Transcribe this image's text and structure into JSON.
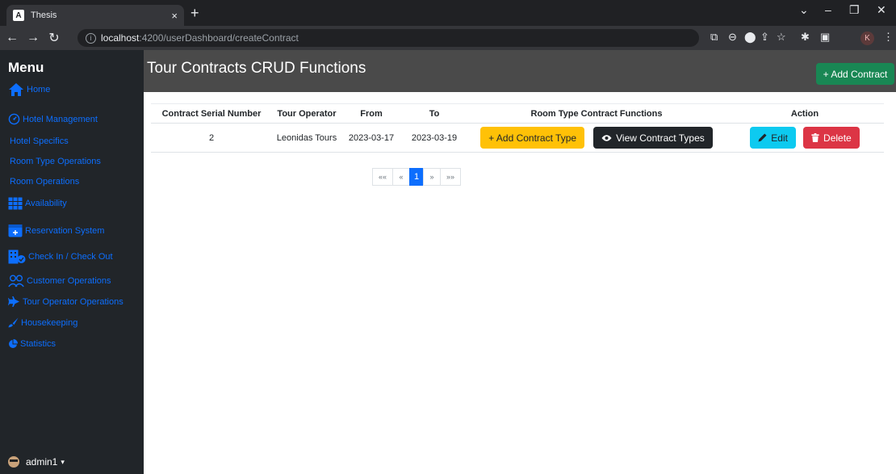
{
  "browser": {
    "tab_title": "Thesis",
    "tab_favicon": "A",
    "tab_close": "×",
    "new_tab": "+",
    "url_host": "localhost",
    "url_path": ":4200/userDashboard/createContract",
    "profile_initial": "K"
  },
  "sidebar": {
    "title": "Menu",
    "items": [
      {
        "label": "Home",
        "icon": "home-icon"
      },
      {
        "label": "Hotel Management",
        "icon": "speedometer-icon"
      },
      {
        "label": "Hotel Specifics"
      },
      {
        "label": "Room Type Operations"
      },
      {
        "label": "Room Operations"
      },
      {
        "label": "Availability",
        "icon": "table-icon"
      },
      {
        "label": "Reservation System",
        "icon": "calendar-plus-icon"
      },
      {
        "label": "Check In / Check Out",
        "icon": "building-check-icon"
      },
      {
        "label": "Customer Operations",
        "icon": "people-icon"
      },
      {
        "label": "Tour Operator Operations",
        "icon": "airplane-icon"
      },
      {
        "label": "Housekeeping",
        "icon": "brush-icon"
      },
      {
        "label": "Statistics",
        "icon": "pie-chart-icon"
      }
    ],
    "user": {
      "name": "admin1",
      "caret": "▾"
    }
  },
  "main": {
    "title": "Tour Contracts CRUD Functions",
    "add_contract_label": "+ Add Contract",
    "table": {
      "headers": [
        "Contract Serial Number",
        "Tour Operator",
        "From",
        "To",
        "Room Type Contract Functions",
        "Action"
      ],
      "rows": [
        {
          "serial": "2",
          "operator": "Leonidas Tours",
          "from": "2023-03-17",
          "to": "2023-03-19"
        }
      ],
      "add_contract_type_label": "+ Add Contract Type",
      "view_contract_types_label": "View Contract Types",
      "edit_label": "Edit",
      "delete_label": "Delete"
    },
    "pagination": {
      "first": "««",
      "prev": "«",
      "current": "1",
      "next": "»",
      "last": "»»"
    }
  },
  "colors": {
    "sidebar_bg": "#212529",
    "header_bg": "#4a4a4a",
    "link": "#0d6efd",
    "success": "#198754",
    "warning": "#ffc107",
    "info": "#0dcaf0",
    "danger": "#dc3545"
  }
}
